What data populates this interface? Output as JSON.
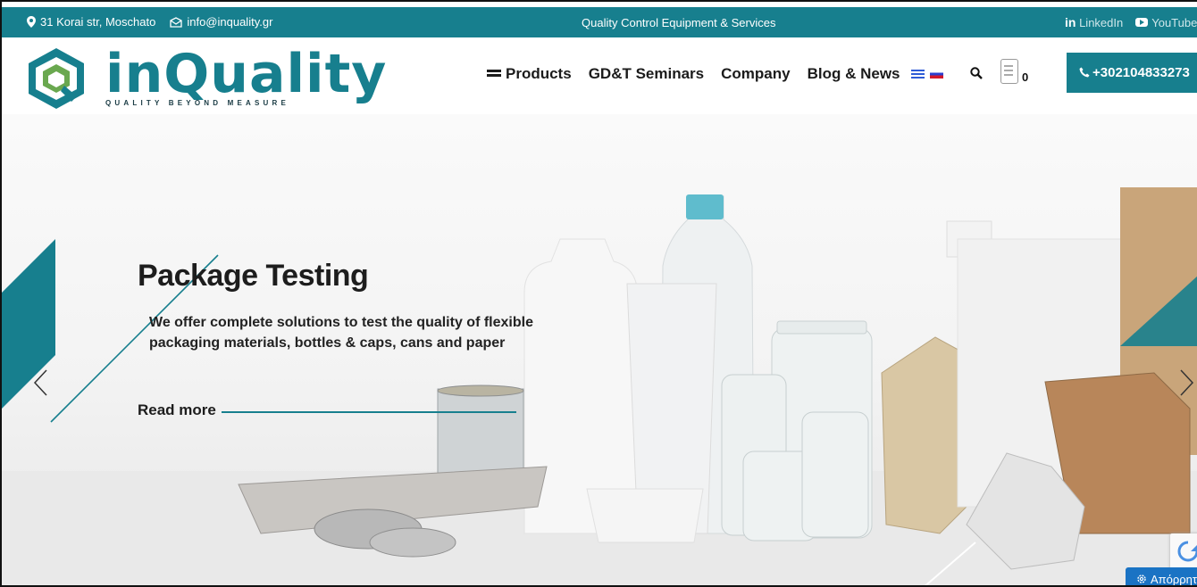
{
  "topbar": {
    "address": "31 Korai str, Moschato",
    "email": "info@inquality.gr",
    "tagline": "Quality Control Equipment & Services",
    "linkedin_label": "LinkedIn",
    "linkedin_glyph": "in",
    "youtube_label": "YouTube"
  },
  "header": {
    "logo_text": "inQuality",
    "logo_tagline": "QUALITY BEYOND MEASURE",
    "nav": {
      "products": "Products",
      "seminars": "GD&T Seminars",
      "company": "Company",
      "blog": "Blog & News"
    },
    "cart_count": "0",
    "phone": "+302104833273"
  },
  "hero": {
    "title": "Package Testing",
    "subtitle": "We offer complete solutions to test the quality of flexible packaging materials, bottles & caps, cans and paper",
    "read_more": "Read more"
  },
  "widgets": {
    "privacy_label": "Απόρρητο"
  },
  "colors": {
    "brand_teal": "#177f8e",
    "logo_green": "#6aa84f",
    "privacy_blue": "#1a73c4"
  }
}
